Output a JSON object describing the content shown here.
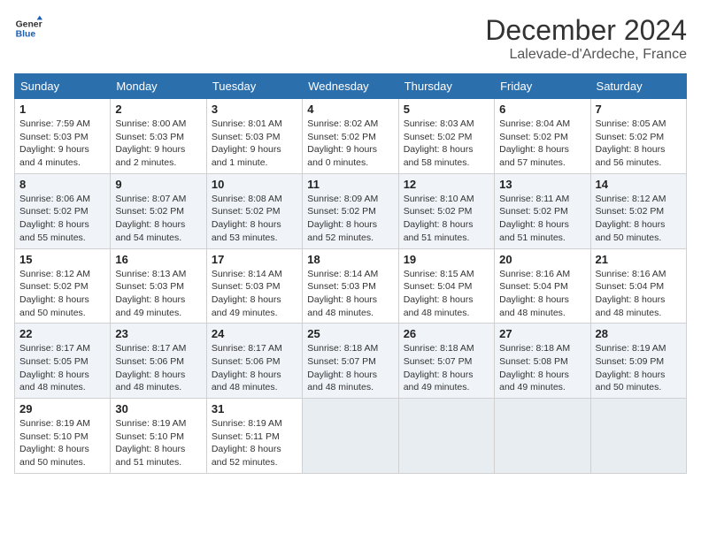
{
  "logo": {
    "line1": "General",
    "line2": "Blue"
  },
  "title": "December 2024",
  "location": "Lalevade-d'Ardeche, France",
  "weekdays": [
    "Sunday",
    "Monday",
    "Tuesday",
    "Wednesday",
    "Thursday",
    "Friday",
    "Saturday"
  ],
  "weeks": [
    [
      {
        "day": "1",
        "sunrise": "Sunrise: 7:59 AM",
        "sunset": "Sunset: 5:03 PM",
        "daylight": "Daylight: 9 hours and 4 minutes."
      },
      {
        "day": "2",
        "sunrise": "Sunrise: 8:00 AM",
        "sunset": "Sunset: 5:03 PM",
        "daylight": "Daylight: 9 hours and 2 minutes."
      },
      {
        "day": "3",
        "sunrise": "Sunrise: 8:01 AM",
        "sunset": "Sunset: 5:03 PM",
        "daylight": "Daylight: 9 hours and 1 minute."
      },
      {
        "day": "4",
        "sunrise": "Sunrise: 8:02 AM",
        "sunset": "Sunset: 5:02 PM",
        "daylight": "Daylight: 9 hours and 0 minutes."
      },
      {
        "day": "5",
        "sunrise": "Sunrise: 8:03 AM",
        "sunset": "Sunset: 5:02 PM",
        "daylight": "Daylight: 8 hours and 58 minutes."
      },
      {
        "day": "6",
        "sunrise": "Sunrise: 8:04 AM",
        "sunset": "Sunset: 5:02 PM",
        "daylight": "Daylight: 8 hours and 57 minutes."
      },
      {
        "day": "7",
        "sunrise": "Sunrise: 8:05 AM",
        "sunset": "Sunset: 5:02 PM",
        "daylight": "Daylight: 8 hours and 56 minutes."
      }
    ],
    [
      {
        "day": "8",
        "sunrise": "Sunrise: 8:06 AM",
        "sunset": "Sunset: 5:02 PM",
        "daylight": "Daylight: 8 hours and 55 minutes."
      },
      {
        "day": "9",
        "sunrise": "Sunrise: 8:07 AM",
        "sunset": "Sunset: 5:02 PM",
        "daylight": "Daylight: 8 hours and 54 minutes."
      },
      {
        "day": "10",
        "sunrise": "Sunrise: 8:08 AM",
        "sunset": "Sunset: 5:02 PM",
        "daylight": "Daylight: 8 hours and 53 minutes."
      },
      {
        "day": "11",
        "sunrise": "Sunrise: 8:09 AM",
        "sunset": "Sunset: 5:02 PM",
        "daylight": "Daylight: 8 hours and 52 minutes."
      },
      {
        "day": "12",
        "sunrise": "Sunrise: 8:10 AM",
        "sunset": "Sunset: 5:02 PM",
        "daylight": "Daylight: 8 hours and 51 minutes."
      },
      {
        "day": "13",
        "sunrise": "Sunrise: 8:11 AM",
        "sunset": "Sunset: 5:02 PM",
        "daylight": "Daylight: 8 hours and 51 minutes."
      },
      {
        "day": "14",
        "sunrise": "Sunrise: 8:12 AM",
        "sunset": "Sunset: 5:02 PM",
        "daylight": "Daylight: 8 hours and 50 minutes."
      }
    ],
    [
      {
        "day": "15",
        "sunrise": "Sunrise: 8:12 AM",
        "sunset": "Sunset: 5:02 PM",
        "daylight": "Daylight: 8 hours and 50 minutes."
      },
      {
        "day": "16",
        "sunrise": "Sunrise: 8:13 AM",
        "sunset": "Sunset: 5:03 PM",
        "daylight": "Daylight: 8 hours and 49 minutes."
      },
      {
        "day": "17",
        "sunrise": "Sunrise: 8:14 AM",
        "sunset": "Sunset: 5:03 PM",
        "daylight": "Daylight: 8 hours and 49 minutes."
      },
      {
        "day": "18",
        "sunrise": "Sunrise: 8:14 AM",
        "sunset": "Sunset: 5:03 PM",
        "daylight": "Daylight: 8 hours and 48 minutes."
      },
      {
        "day": "19",
        "sunrise": "Sunrise: 8:15 AM",
        "sunset": "Sunset: 5:04 PM",
        "daylight": "Daylight: 8 hours and 48 minutes."
      },
      {
        "day": "20",
        "sunrise": "Sunrise: 8:16 AM",
        "sunset": "Sunset: 5:04 PM",
        "daylight": "Daylight: 8 hours and 48 minutes."
      },
      {
        "day": "21",
        "sunrise": "Sunrise: 8:16 AM",
        "sunset": "Sunset: 5:04 PM",
        "daylight": "Daylight: 8 hours and 48 minutes."
      }
    ],
    [
      {
        "day": "22",
        "sunrise": "Sunrise: 8:17 AM",
        "sunset": "Sunset: 5:05 PM",
        "daylight": "Daylight: 8 hours and 48 minutes."
      },
      {
        "day": "23",
        "sunrise": "Sunrise: 8:17 AM",
        "sunset": "Sunset: 5:06 PM",
        "daylight": "Daylight: 8 hours and 48 minutes."
      },
      {
        "day": "24",
        "sunrise": "Sunrise: 8:17 AM",
        "sunset": "Sunset: 5:06 PM",
        "daylight": "Daylight: 8 hours and 48 minutes."
      },
      {
        "day": "25",
        "sunrise": "Sunrise: 8:18 AM",
        "sunset": "Sunset: 5:07 PM",
        "daylight": "Daylight: 8 hours and 48 minutes."
      },
      {
        "day": "26",
        "sunrise": "Sunrise: 8:18 AM",
        "sunset": "Sunset: 5:07 PM",
        "daylight": "Daylight: 8 hours and 49 minutes."
      },
      {
        "day": "27",
        "sunrise": "Sunrise: 8:18 AM",
        "sunset": "Sunset: 5:08 PM",
        "daylight": "Daylight: 8 hours and 49 minutes."
      },
      {
        "day": "28",
        "sunrise": "Sunrise: 8:19 AM",
        "sunset": "Sunset: 5:09 PM",
        "daylight": "Daylight: 8 hours and 50 minutes."
      }
    ],
    [
      {
        "day": "29",
        "sunrise": "Sunrise: 8:19 AM",
        "sunset": "Sunset: 5:10 PM",
        "daylight": "Daylight: 8 hours and 50 minutes."
      },
      {
        "day": "30",
        "sunrise": "Sunrise: 8:19 AM",
        "sunset": "Sunset: 5:10 PM",
        "daylight": "Daylight: 8 hours and 51 minutes."
      },
      {
        "day": "31",
        "sunrise": "Sunrise: 8:19 AM",
        "sunset": "Sunset: 5:11 PM",
        "daylight": "Daylight: 8 hours and 52 minutes."
      },
      null,
      null,
      null,
      null
    ]
  ]
}
